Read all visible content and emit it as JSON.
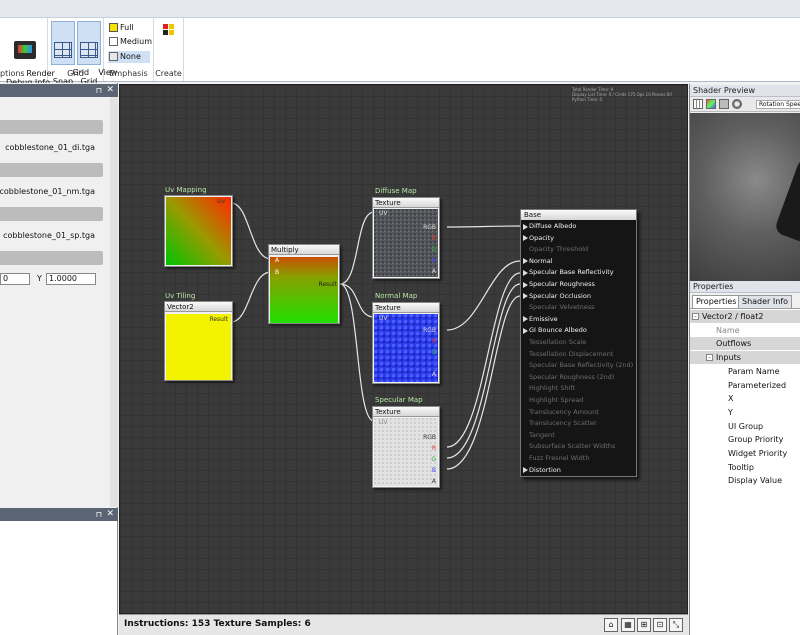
{
  "ribbon": {
    "render_debug_label": "Render\nDebug Info",
    "options_group_label": "ptions",
    "grid_snap_label": "Grid\nSnap",
    "view_grid_label": "View\nGrid",
    "grid_group_label": "Grid",
    "emphasis_full": "Full",
    "emphasis_medium": "Medium",
    "emphasis_none": "None",
    "emphasis_group_label": "Emphasis",
    "create_group_label": "Create"
  },
  "left_panel": {
    "texture_1": "cobblestone_01_di.tga",
    "texture_2": "cobblestone_01_nm.tga",
    "texture_3": "cobblestone_01_sp.tga",
    "field_x_value": "0",
    "field_y_label": "Y",
    "field_y_value": "1.0000"
  },
  "canvas": {
    "stats_text": "Total Render Time: 9\nDisplay List Time: 0 / Cmds 175 Ops 10 Passes 60\nPython Time: 0",
    "uv_mapping_label": "Uv Mapping",
    "uv_tiling_label": "Uv Tiling",
    "vector2_title": "Vector2",
    "multiply_title": "Multiply",
    "diffuse_map_label": "Diffuse Map",
    "normal_map_label": "Normal Map",
    "specular_map_label": "Specular Map",
    "texture_title": "Texture",
    "port_uv_out": "Uv",
    "port_result": "Result",
    "port_a": "A",
    "port_b": "B",
    "port_uv_in": "UV",
    "port_rgb": "RGB",
    "port_r": "R",
    "port_g": "G",
    "port_bb": "B",
    "port_alpha": "A",
    "base_title": "Base",
    "base_rows": [
      {
        "label": "Diffuse Albedo",
        "active": true
      },
      {
        "label": "Opacity",
        "active": true
      },
      {
        "label": "Opacity Threshold",
        "active": false
      },
      {
        "label": "Normal",
        "active": true
      },
      {
        "label": "Specular Base Reflectivity",
        "active": true
      },
      {
        "label": "Specular Roughness",
        "active": true
      },
      {
        "label": "Specular Occlusion",
        "active": true
      },
      {
        "label": "Specular Velvetness",
        "active": false
      },
      {
        "label": "Emissive",
        "active": true
      },
      {
        "label": "GI Bounce Albedo",
        "active": true
      },
      {
        "label": "Tessellation Scale",
        "active": false
      },
      {
        "label": "Tessellation Displacement",
        "active": false
      },
      {
        "label": "Specular Base Reflectivity (2nd)",
        "active": false
      },
      {
        "label": "Specular Roughness (2nd)",
        "active": false
      },
      {
        "label": "Highlight Shift",
        "active": false
      },
      {
        "label": "Highlight Spread",
        "active": false
      },
      {
        "label": "Translucency Amount",
        "active": false
      },
      {
        "label": "Translucency Scatter",
        "active": false
      },
      {
        "label": "Tangent",
        "active": false
      },
      {
        "label": "Subsurface Scatter Widths",
        "active": false
      },
      {
        "label": "Fuzz Fresnel Width",
        "active": false
      },
      {
        "label": "Distortion",
        "active": true
      }
    ]
  },
  "status": {
    "text": "Instructions: 153   Texture Samples: 6"
  },
  "right_panel": {
    "shader_preview_title": "Shader Preview",
    "rotation_label": "Rotation Speed",
    "properties_title": "Properties",
    "tab_properties": "Properties",
    "tab_shader_info": "Shader Info",
    "tree": [
      {
        "label": "Vector2 / float2",
        "indent": 12,
        "toggle": "-",
        "style": "header"
      },
      {
        "label": "Name",
        "indent": 26,
        "toggle": "",
        "style": "muted"
      },
      {
        "label": "Outflows",
        "indent": 26,
        "toggle": "",
        "style": "header"
      },
      {
        "label": "Inputs",
        "indent": 26,
        "toggle": "-",
        "style": "header"
      },
      {
        "label": "Param Name",
        "indent": 38,
        "toggle": "",
        "style": "normal"
      },
      {
        "label": "Parameterized",
        "indent": 38,
        "toggle": "",
        "style": "normal"
      },
      {
        "label": "X",
        "indent": 38,
        "toggle": "",
        "style": "normal"
      },
      {
        "label": "Y",
        "indent": 38,
        "toggle": "",
        "style": "normal"
      },
      {
        "label": "UI Group",
        "indent": 38,
        "toggle": "",
        "style": "normal"
      },
      {
        "label": "Group Priority",
        "indent": 38,
        "toggle": "",
        "style": "normal"
      },
      {
        "label": "Widget Priority",
        "indent": 38,
        "toggle": "",
        "style": "normal"
      },
      {
        "label": "Tooltip",
        "indent": 38,
        "toggle": "",
        "style": "normal"
      },
      {
        "label": "Display Value",
        "indent": 38,
        "toggle": "",
        "style": "normal"
      }
    ]
  }
}
